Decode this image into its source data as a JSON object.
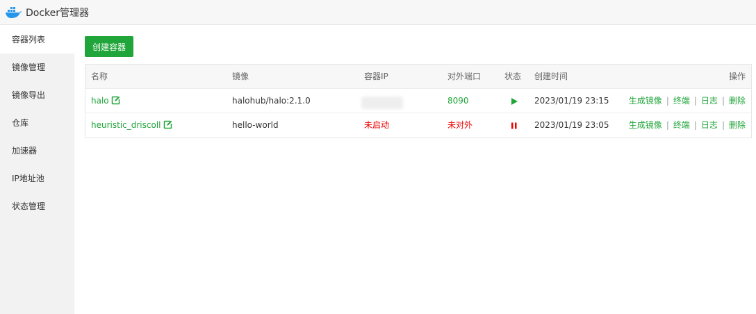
{
  "window": {
    "title": "Docker管理器"
  },
  "sidebar": {
    "items": [
      {
        "label": "容器列表",
        "active": true
      },
      {
        "label": "镜像管理"
      },
      {
        "label": "镜像导出"
      },
      {
        "label": "仓库"
      },
      {
        "label": "加速器"
      },
      {
        "label": "IP地址池"
      },
      {
        "label": "状态管理"
      }
    ]
  },
  "toolbar": {
    "create_label": "创建容器"
  },
  "table": {
    "headers": {
      "name": "名称",
      "image": "镜像",
      "ip": "容器IP",
      "port": "对外端口",
      "status": "状态",
      "created": "创建时间",
      "ops": "操作"
    },
    "rows": [
      {
        "name": "halo",
        "image": "halohub/halo:2.1.0",
        "ip": "",
        "port": "8090",
        "status": "running",
        "created": "2023/01/19 23:15"
      },
      {
        "name": "heuristic_driscoll",
        "image": "hello-world",
        "ip": "未启动",
        "port": "未对外",
        "status": "stopped",
        "created": "2023/01/19 23:05"
      }
    ],
    "actions": {
      "generate_image": "生成镜像",
      "terminal": "终端",
      "log": "日志",
      "delete": "删除",
      "separator": "|"
    }
  },
  "colors": {
    "accent": "#20a53a",
    "danger": "#ee0000"
  },
  "icons": {
    "logo": "docker-whale-icon",
    "edit": "edit-icon",
    "running": "play-icon",
    "stopped": "pause-icon"
  }
}
